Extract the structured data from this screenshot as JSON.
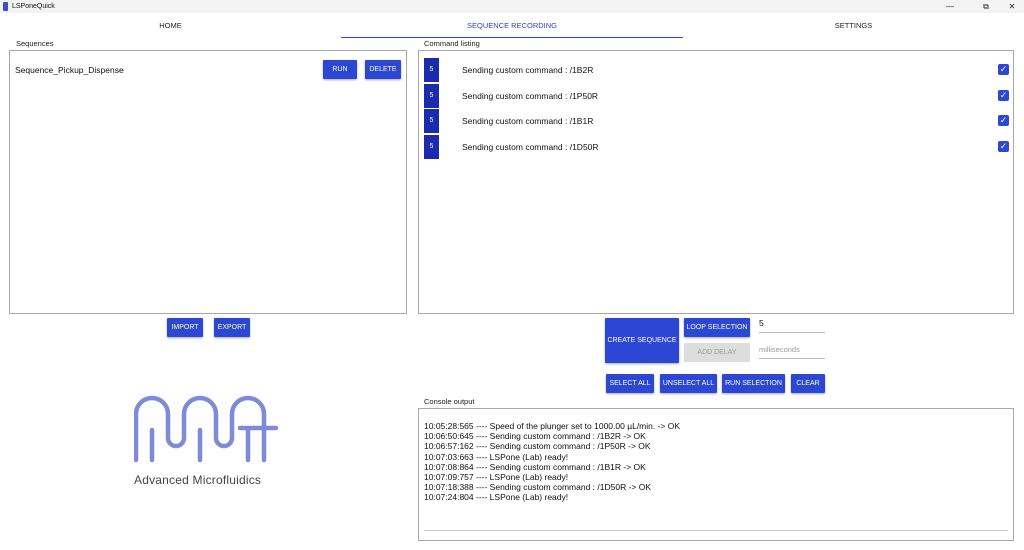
{
  "window": {
    "title": "LSPoneQuick",
    "minimize": "—",
    "maximize": "⧉",
    "close": "✕"
  },
  "tabs": [
    {
      "label": "HOME"
    },
    {
      "label": "SEQUENCE RECORDING",
      "active": true
    },
    {
      "label": "SETTINGS"
    }
  ],
  "sequences": {
    "title": "Sequences",
    "items": [
      {
        "name": "Sequence_Pickup_Dispense",
        "run_label": "RUN",
        "delete_label": "DELETE"
      }
    ],
    "import_label": "IMPORT",
    "export_label": "EXPORT"
  },
  "command_listing": {
    "title": "Command listing",
    "commands": [
      {
        "count": "5",
        "text": "Sending custom command : /1B2R",
        "checked": true
      },
      {
        "count": "5",
        "text": "Sending custom command : /1P50R",
        "checked": true
      },
      {
        "count": "5",
        "text": "Sending custom command : /1B1R",
        "checked": true
      },
      {
        "count": "5",
        "text": "Sending custom command : /1D50R",
        "checked": true
      }
    ],
    "check_glyph": "✓"
  },
  "controls": {
    "create_sequence": "CREATE SEQUENCE",
    "loop_selection": "LOOP SELECTION",
    "loop_value": "5",
    "add_delay": "ADD DELAY",
    "delay_placeholder": "milliseconds",
    "select_all": "SELECT ALL",
    "unselect_all": "UNSELECT ALL",
    "run_selection": "RUN SELECTION",
    "clear": "CLEAR"
  },
  "logo": {
    "text": "Advanced Microfluidics",
    "color": "#7f8bd9"
  },
  "console": {
    "title": "Console output",
    "lines": [
      "10:05:28:565 ---- Speed of the plunger set to 1000.00 µL/min. -> OK",
      "10:06:50:645 ---- Sending custom command : /1B2R -> OK",
      "10:06:57:162 ---- Sending custom command : /1P50R -> OK",
      "10:07:03:663 ---- LSPone (Lab) ready!",
      "10:07:08:864 ---- Sending custom command : /1B1R -> OK",
      "10:07:09:757 ---- LSPone (Lab) ready!",
      "10:07:18:388 ---- Sending custom command : /1D50R -> OK",
      "10:07:24:804 ---- LSPone (Lab) ready!"
    ]
  },
  "colors": {
    "accent": "#2c47d4",
    "counter_bg": "#1c2ab0"
  }
}
